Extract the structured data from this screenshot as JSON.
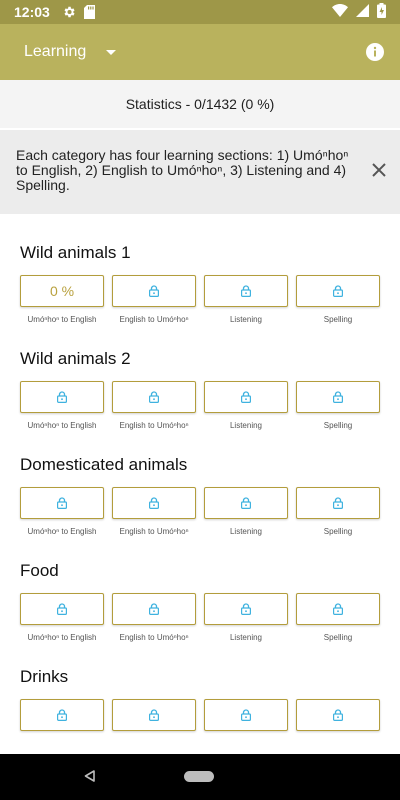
{
  "status_bar": {
    "time": "12:03"
  },
  "app_bar": {
    "title": "Learning"
  },
  "statistics": "Statistics - 0/1432 (0 %)",
  "notice": {
    "text": "Each category has four learning sections: 1) Umóⁿhoⁿ to English, 2) English to Umóⁿhoⁿ, 3) Listening and 4) Spelling."
  },
  "categories": [
    {
      "title": "Wild animals 1",
      "progress_label": "0 %",
      "captions": [
        "Umóⁿhoⁿ to English",
        "English to Umóⁿhoⁿ",
        "Listening",
        "Spelling"
      ]
    },
    {
      "title": "Wild animals 2",
      "captions": [
        "Umóⁿhoⁿ to English",
        "English to Umóⁿhoⁿ",
        "Listening",
        "Spelling"
      ]
    },
    {
      "title": "Domesticated animals",
      "captions": [
        "Umóⁿhoⁿ to English",
        "English to Umóⁿhoⁿ",
        "Listening",
        "Spelling"
      ]
    },
    {
      "title": "Food",
      "captions": [
        "Umóⁿhoⁿ to English",
        "English to Umóⁿhoⁿ",
        "Listening",
        "Spelling"
      ]
    },
    {
      "title": "Drinks"
    }
  ],
  "icons": {
    "locked": "lock-icon",
    "close": "close-icon",
    "info": "info-icon",
    "dropdown": "dropdown-caret-icon"
  },
  "colors": {
    "app_bar": "#b9b25d",
    "status_bar": "#9e9748",
    "tile_border": "#b39d3c",
    "lock": "#3fb2df"
  }
}
